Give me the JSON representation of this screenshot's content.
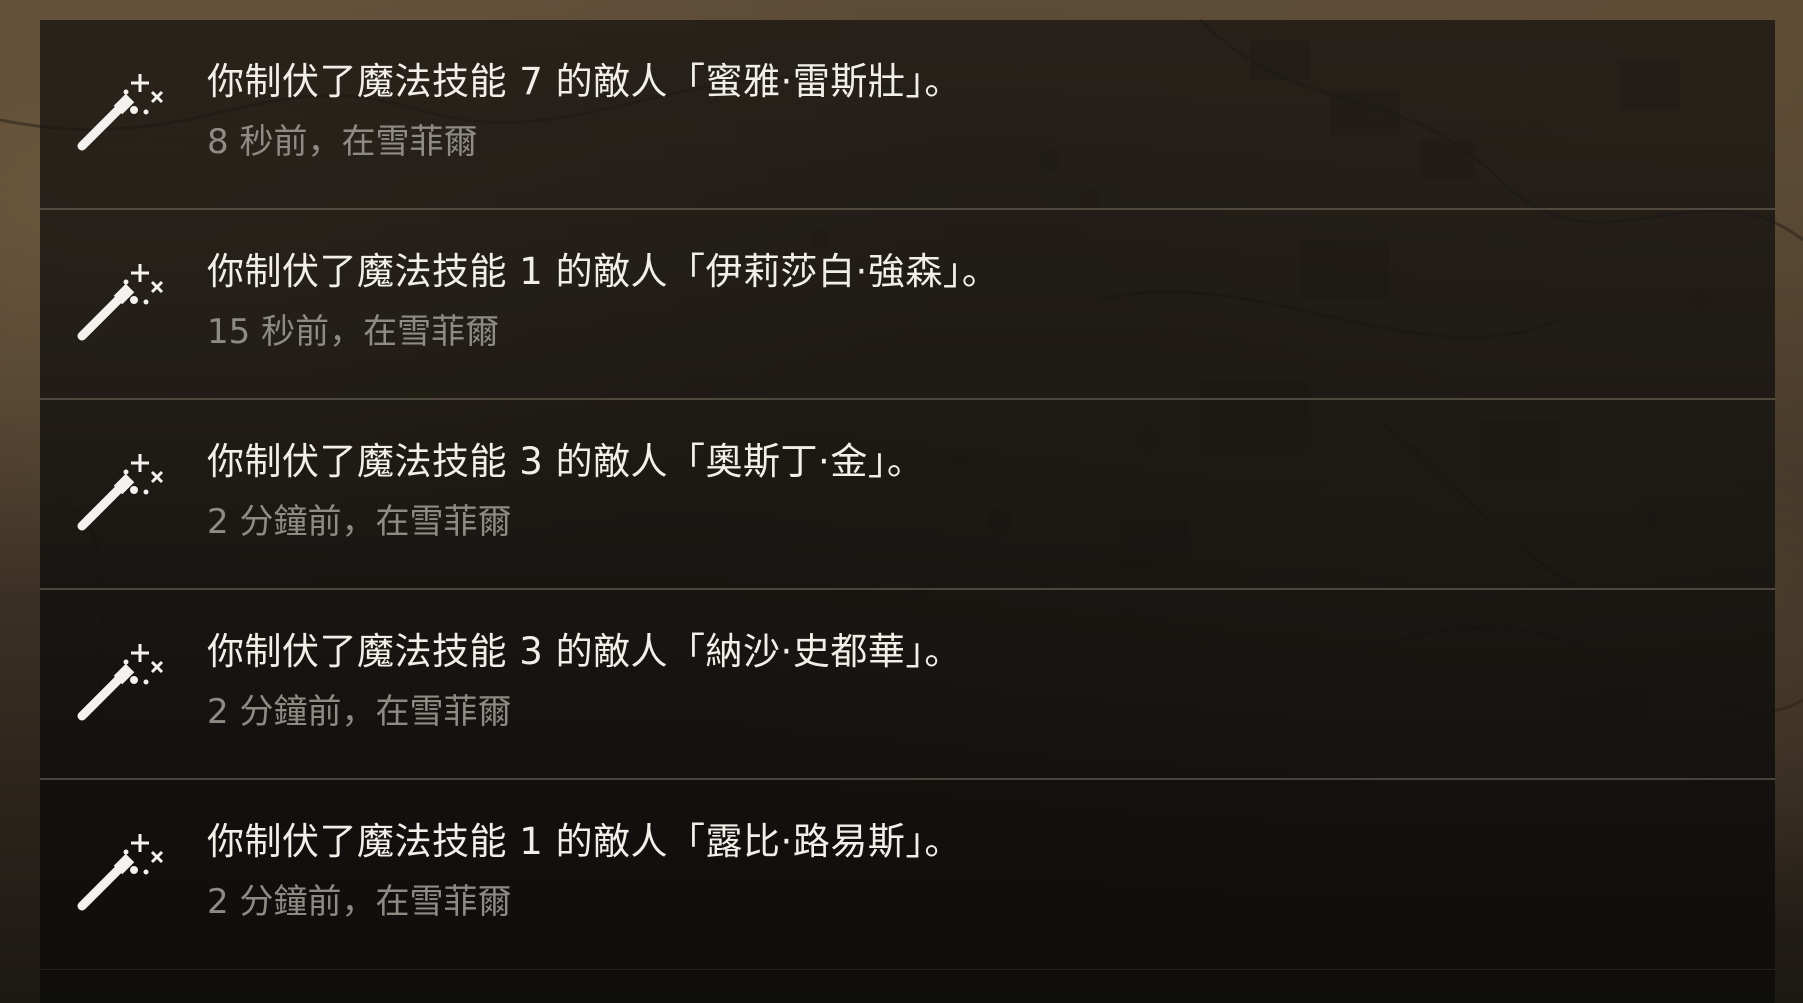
{
  "notifications": [
    {
      "icon": "magic-wand-icon",
      "message": "你制伏了魔法技能 7 的敵人「蜜雅·雷斯壯」。",
      "meta": "8 秒前，在雪菲爾"
    },
    {
      "icon": "magic-wand-icon",
      "message": "你制伏了魔法技能 1 的敵人「伊莉莎白·強森」。",
      "meta": "15 秒前，在雪菲爾"
    },
    {
      "icon": "magic-wand-icon",
      "message": "你制伏了魔法技能 3 的敵人「奧斯丁·金」。",
      "meta": "2 分鐘前，在雪菲爾"
    },
    {
      "icon": "magic-wand-icon",
      "message": "你制伏了魔法技能 3 的敵人「納沙·史都華」。",
      "meta": "2 分鐘前，在雪菲爾"
    },
    {
      "icon": "magic-wand-icon",
      "message": "你制伏了魔法技能 1 的敵人「露比·路易斯」。",
      "meta": "2 分鐘前，在雪菲爾"
    }
  ],
  "colors": {
    "title_text": "#f2efe9",
    "meta_text": "#8e8a84",
    "divider": "#786e5f"
  }
}
